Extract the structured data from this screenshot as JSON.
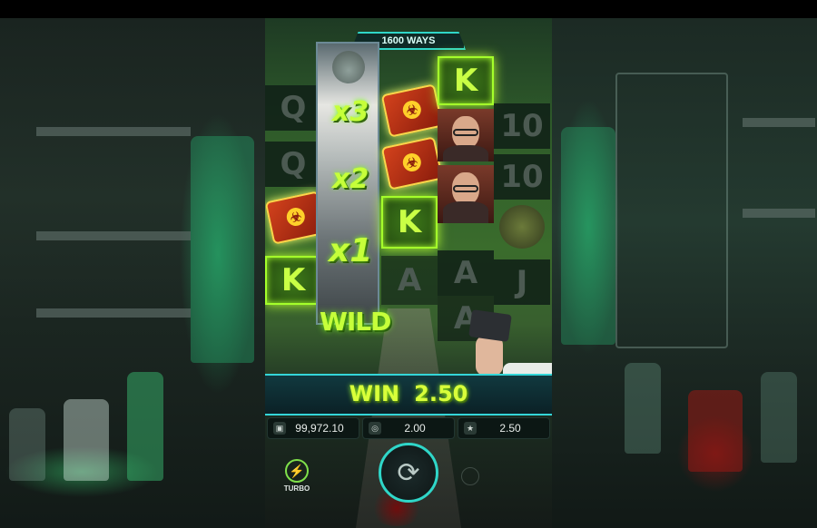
{
  "ways": "1600 WAYS",
  "reels": {
    "col1": [
      "Q",
      "Q",
      "K"
    ],
    "col3_symbol": "K",
    "col3_top_symbol": "K",
    "col4": [
      "A",
      "A"
    ],
    "col4_lower": "A",
    "col3_lower": "A",
    "col5": [
      "10",
      "10",
      "J"
    ]
  },
  "multipliers": [
    "x3",
    "x2",
    "x1"
  ],
  "wild_label": "WILD",
  "win": {
    "label": "WIN",
    "amount": "2.50"
  },
  "stats": {
    "balance": "99,972.10",
    "bet": "2.00",
    "win": "2.50"
  },
  "turbo_label": "TURBO",
  "icons": {
    "balance": "wallet-icon",
    "bet": "coins-icon",
    "win": "win-icon",
    "spin": "spin-icon",
    "turbo": "turbo-icon"
  }
}
